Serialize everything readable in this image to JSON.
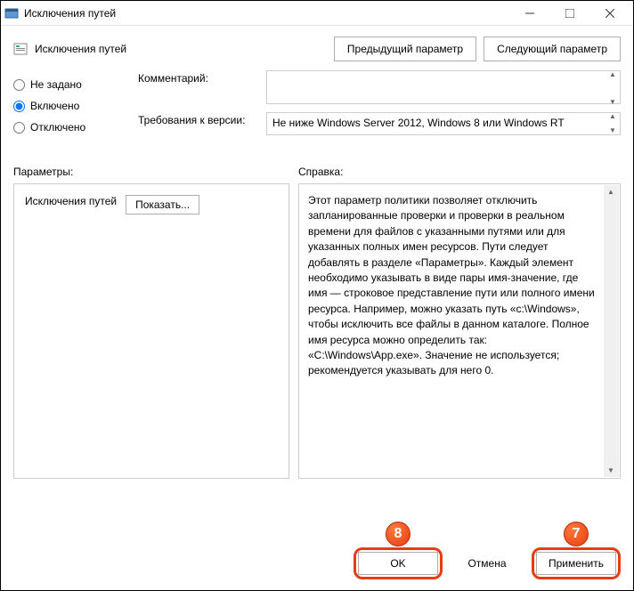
{
  "window": {
    "title": "Исключения путей"
  },
  "header": {
    "title": "Исключения путей",
    "prev": "Предыдущий параметр",
    "next": "Следующий параметр"
  },
  "radios": {
    "not_set": "Не задано",
    "enabled": "Включено",
    "disabled": "Отключено"
  },
  "fields": {
    "comment_label": "Комментарий:",
    "comment_value": "",
    "requirements_label": "Требования к версии:",
    "requirements_value": "Не ниже Windows Server 2012, Windows 8 или Windows RT"
  },
  "labels": {
    "params": "Параметры:",
    "help": "Справка:"
  },
  "params": {
    "item_label": "Исключения путей",
    "show_btn": "Показать..."
  },
  "help": {
    "text": "Этот параметр политики позволяет отключить запланированные проверки и проверки в реальном времени для файлов с указанными путями или для указанных полных имен ресурсов. Пути следует добавлять в разделе «Параметры». Каждый элемент необходимо указывать в виде пары имя-значение, где имя — строковое представление пути или полного имени ресурса. Например, можно указать путь «c:\\Windows», чтобы исключить все файлы в данном каталоге. Полное имя ресурса можно определить так: «C:\\Windows\\App.exe». Значение не используется; рекомендуется указывать для него 0."
  },
  "footer": {
    "ok": "OK",
    "cancel": "Отмена",
    "apply": "Применить"
  },
  "badges": {
    "ok": "8",
    "apply": "7"
  }
}
